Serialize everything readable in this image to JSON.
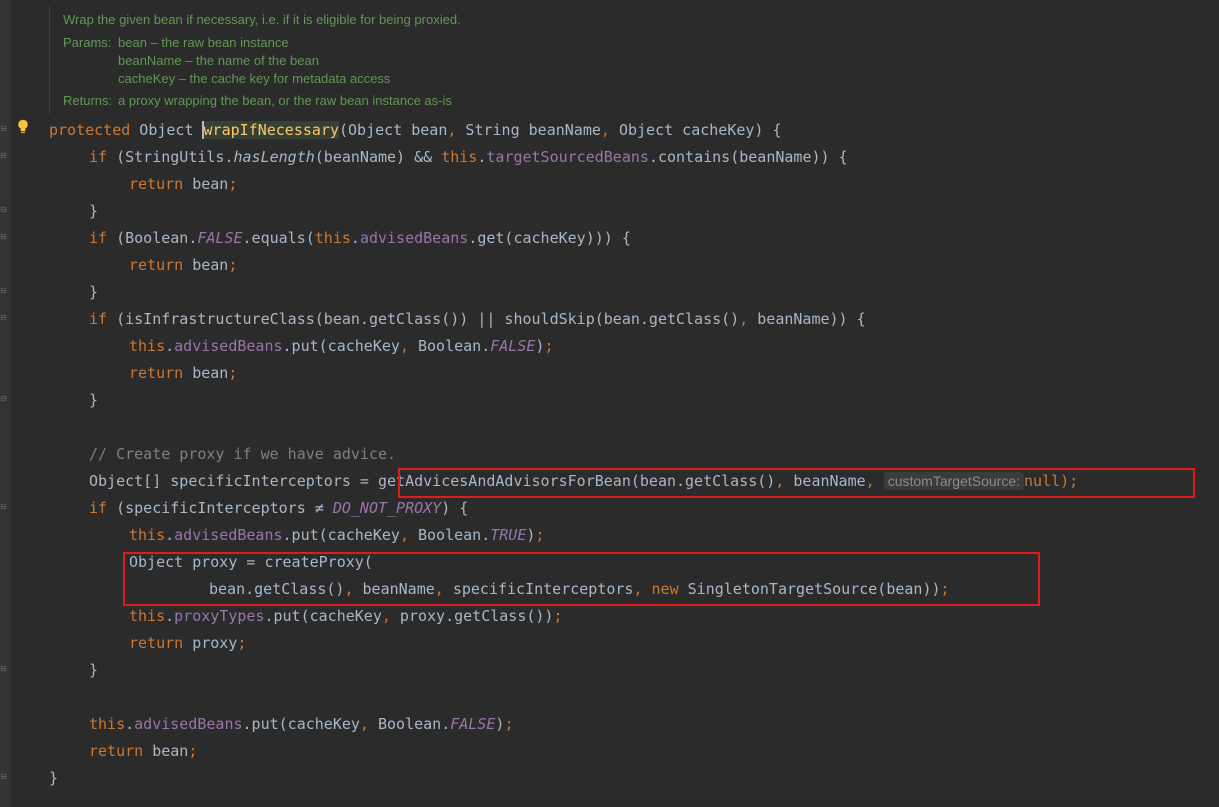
{
  "doc": {
    "summary": "Wrap the given bean if necessary, i.e. if it is eligible for being proxied.",
    "params_label": "Params:",
    "param_bean": "bean – the raw bean instance",
    "param_beanName": "beanName – the name of the bean",
    "param_cacheKey": "cacheKey – the cache key for metadata access",
    "returns_label": "Returns:",
    "returns_text": "a proxy wrapping the bean, or the raw bean instance as-is"
  },
  "code": {
    "l1": {
      "a": "protected",
      "b": " Object ",
      "fn": "wrapIfNecessary",
      "c": "(Object bean",
      "d": ",",
      "e": " String beanName",
      "f": ",",
      "g": " Object cacheKey) {"
    },
    "l2": {
      "a": "if",
      "b": " (StringUtils.",
      "c": "hasLength",
      "d": "(beanName) && ",
      "e": "this",
      "f": ".",
      "g": "targetSourcedBeans",
      "h": ".contains(beanName)) {"
    },
    "l3": {
      "a": "return",
      "b": " bean",
      "c": ";"
    },
    "l4": "}",
    "l5": {
      "a": "if",
      "b": " (Boolean.",
      "c": "FALSE",
      "d": ".equals(",
      "e": "this",
      "f": ".",
      "g": "advisedBeans",
      "h": ".get(cacheKey))) {"
    },
    "l6": {
      "a": "return",
      "b": " bean",
      "c": ";"
    },
    "l7": "}",
    "l8": {
      "a": "if",
      "b": " (isInfrastructureClass(bean.getClass()) || shouldSkip(bean.getClass()",
      "c": ",",
      "d": " beanName)) {"
    },
    "l9": {
      "a": "this",
      "b": ".",
      "c": "advisedBeans",
      "d": ".put(cacheKey",
      "e": ",",
      "f": " Boolean.",
      "g": "FALSE",
      "h": ")",
      "i": ";"
    },
    "l10": {
      "a": "return",
      "b": " bean",
      "c": ";"
    },
    "l11": "}",
    "l12": "// Create proxy if we have advice.",
    "l13": {
      "a": "Object[] specificInterceptors = ",
      "b": "getAdvicesAndAdvisorsForBean(bean.getClass()",
      "c": ",",
      "d": " beanName",
      "e": ",",
      "hint": "customTargetSource:",
      "f": "null)",
      "g": ";"
    },
    "l14": {
      "a": "if",
      "b": " (specificInterceptors ≠ ",
      "c": "DO_NOT_PROXY",
      "d": ") {"
    },
    "l15": {
      "a": "this",
      "b": ".",
      "c": "advisedBeans",
      "d": ".put(cacheKey",
      "e": ",",
      "f": " Boolean.",
      "g": "TRUE",
      "h": ")",
      "i": ";"
    },
    "l16": "Object proxy = createProxy(",
    "l17": {
      "a": "bean.getClass()",
      "b": ",",
      "c": " beanName",
      "d": ",",
      "e": " specificInterceptors",
      "f": ",",
      "g": " new",
      "h": " SingletonTargetSource(bean))",
      "i": ";"
    },
    "l18": {
      "a": "this",
      "b": ".",
      "c": "proxyTypes",
      "d": ".put(cacheKey",
      "e": ",",
      "f": " proxy.getClass())",
      "g": ";"
    },
    "l19": {
      "a": "return",
      "b": " proxy",
      "c": ";"
    },
    "l20": "}",
    "l21": {
      "a": "this",
      "b": ".",
      "c": "advisedBeans",
      "d": ".put(cacheKey",
      "e": ",",
      "f": " Boolean.",
      "g": "FALSE",
      "h": ")",
      "i": ";"
    },
    "l22": {
      "a": "return",
      "b": " bean",
      "c": ";"
    },
    "l23": "}"
  },
  "colors": {
    "background": "#2b2b2b",
    "keyword": "#cc7832",
    "method": "#ffc66d",
    "field": "#9876aa",
    "text": "#a9b7c6",
    "comment": "#808080",
    "doc": "#629755",
    "callout": "#e01b1b"
  },
  "icons": [
    "intention-bulb-icon",
    "fold-marker-icon"
  ]
}
